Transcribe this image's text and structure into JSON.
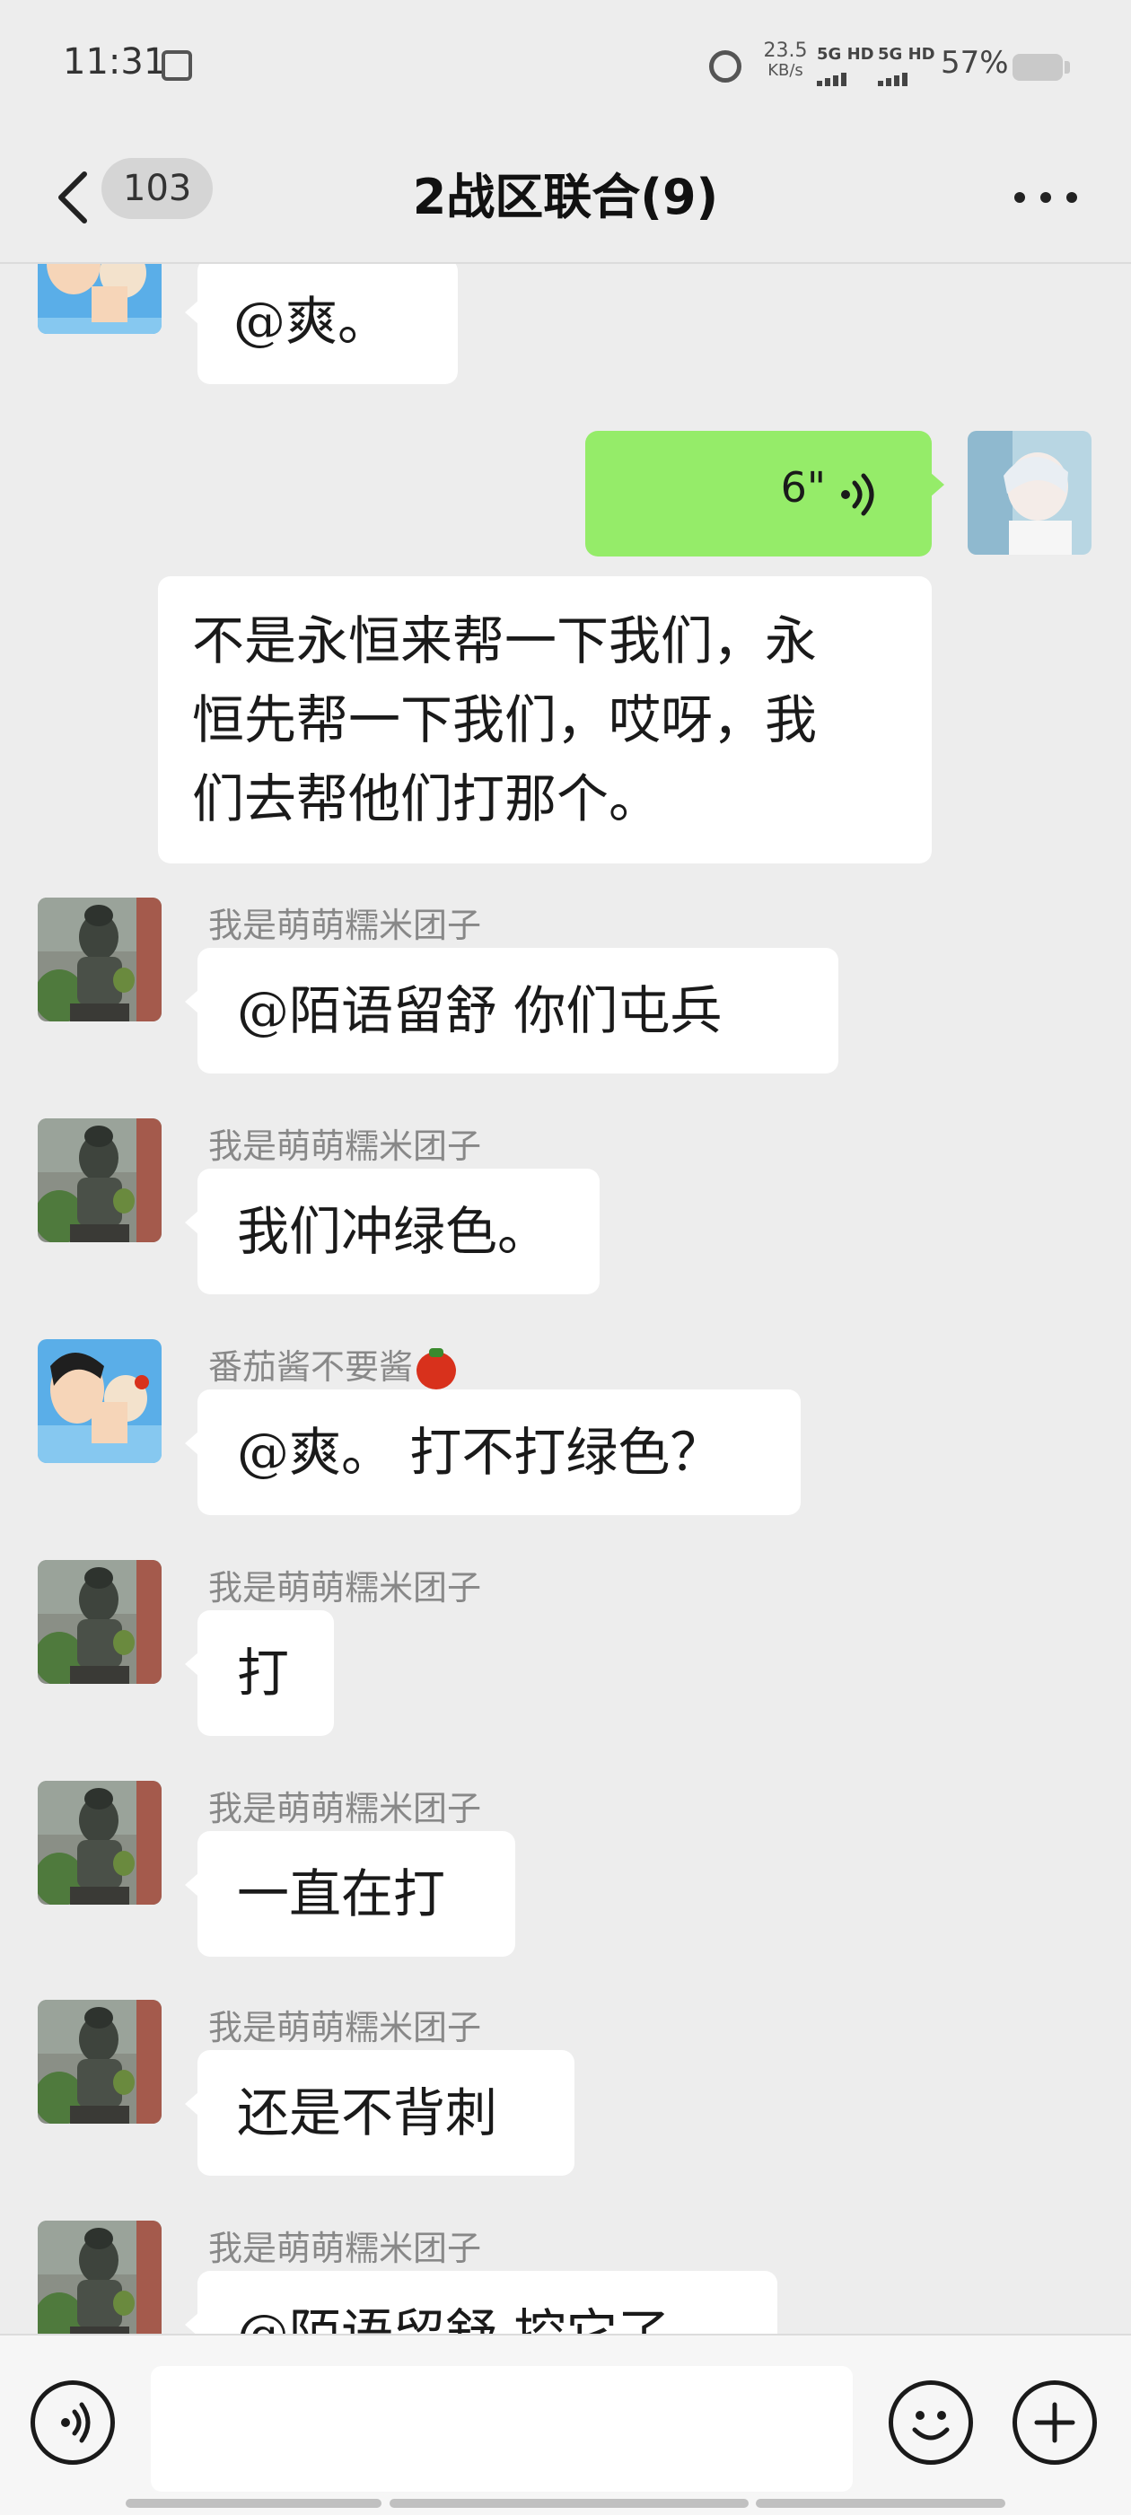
{
  "status_bar": {
    "time": "11:31",
    "speed_value": "23.5",
    "speed_unit": "KB/s",
    "network_1": "5G HD",
    "network_2": "5G HD",
    "battery_text": "57%",
    "battery_level": 0.57
  },
  "header": {
    "unread_count": "103",
    "title": "2战区联合(9)"
  },
  "messages": [
    {
      "type": "text",
      "side": "left",
      "avatar": "cartoon-avatar",
      "sender": "",
      "text": "@爽。"
    },
    {
      "type": "voice",
      "side": "right",
      "avatar": "white-hair-avatar",
      "duration": "6\""
    },
    {
      "type": "text",
      "side": "right",
      "avatar": "",
      "lines": [
        "不是永恒来帮一下我们，永",
        "恒先帮一下我们，哎呀，我",
        "们去帮他们打那个。"
      ]
    },
    {
      "type": "text",
      "side": "left",
      "avatar": "statue-avatar",
      "sender": "我是萌萌糯米团子",
      "text": "@陌语留舒  你们屯兵"
    },
    {
      "type": "text",
      "side": "left",
      "avatar": "statue-avatar",
      "sender": "我是萌萌糯米团子",
      "text": "我们冲绿色。"
    },
    {
      "type": "text",
      "side": "left",
      "avatar": "cartoon-avatar",
      "sender": "番茄酱不要酱",
      "sender_emoji": "tomato-icon",
      "text": "@爽。 打不打绿色？"
    },
    {
      "type": "text",
      "side": "left",
      "avatar": "statue-avatar",
      "sender": "我是萌萌糯米团子",
      "text": "打"
    },
    {
      "type": "text",
      "side": "left",
      "avatar": "statue-avatar",
      "sender": "我是萌萌糯米团子",
      "text": "一直在打"
    },
    {
      "type": "text",
      "side": "left",
      "avatar": "statue-avatar",
      "sender": "我是萌萌糯米团子",
      "text": "还是不背刺"
    },
    {
      "type": "text",
      "side": "left",
      "avatar": "statue-avatar",
      "sender": "我是萌萌糯米团子",
      "text": "@陌语留舒  控它了"
    }
  ],
  "input_bar": {
    "voice_icon": "voice-mode-icon",
    "emoji_icon": "emoji-icon",
    "plus_icon": "plus-icon",
    "placeholder": ""
  },
  "colors": {
    "background": "#ededed",
    "sent_bubble": "#95ec69",
    "received_bubble": "#ffffff"
  }
}
